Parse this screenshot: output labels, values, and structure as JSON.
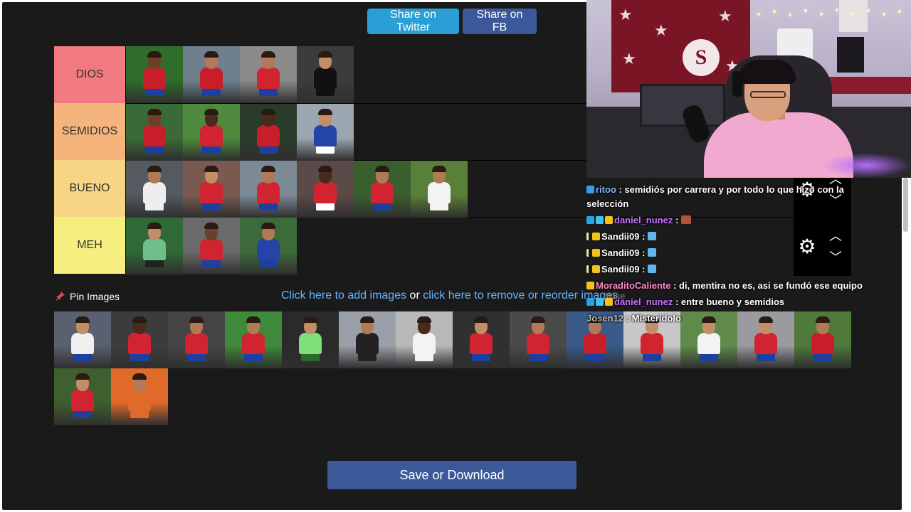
{
  "header": {
    "share_twitter": "Share on Twitter",
    "share_fb": "Share on FB"
  },
  "tiers": [
    {
      "label": "DIOS",
      "color": "#f07a7f",
      "players": [
        {
          "bg": "#2e6d2a",
          "shirt": "#c81e2a",
          "skin": "#6b3f2a",
          "shorts": "#1f3fa0"
        },
        {
          "bg": "#6f7f8c",
          "shirt": "#c81e2a",
          "skin": "#b07a56",
          "shorts": "#1f3fa0"
        },
        {
          "bg": "#8a8a8a",
          "shirt": "#d22430",
          "skin": "#b07a56",
          "shorts": "#1f3fa0"
        },
        {
          "bg": "#3c3c3c",
          "shirt": "#111111",
          "skin": "#c38d68",
          "shorts": "#111111"
        }
      ]
    },
    {
      "label": "SEMIDIOS",
      "color": "#f5b47c",
      "players": [
        {
          "bg": "#3a6a35",
          "shirt": "#c81e2a",
          "skin": "#6b3f2a",
          "shorts": "#1f3fa0"
        },
        {
          "bg": "#4f8a3e",
          "shirt": "#d22430",
          "skin": "#4a2a1c",
          "shorts": "#1f3fa0"
        },
        {
          "bg": "#2b3b2a",
          "shirt": "#c81e2a",
          "skin": "#4a2a1c",
          "shorts": "#1f3fa0"
        },
        {
          "bg": "#9aa6b0",
          "shirt": "#2444a8",
          "skin": "#c38d68",
          "shorts": "#ffffff"
        }
      ]
    },
    {
      "label": "BUENO",
      "color": "#f6d584",
      "players": [
        {
          "bg": "#555a60",
          "shirt": "#eeeeee",
          "skin": "#b07a56",
          "shorts": "#eeeeee"
        },
        {
          "bg": "#7a5a50",
          "shirt": "#d22430",
          "skin": "#c38d68",
          "shorts": "#1f3fa0"
        },
        {
          "bg": "#7c8a96",
          "shirt": "#d22430",
          "skin": "#b07a56",
          "shorts": "#1f3fa0"
        },
        {
          "bg": "#5c4a48",
          "shirt": "#d22430",
          "skin": "#4a2a1c",
          "shorts": "#ffffff"
        },
        {
          "bg": "#3a5f2f",
          "shirt": "#d22430",
          "skin": "#b07a56",
          "shorts": "#1f3fa0"
        },
        {
          "bg": "#5a7f38",
          "shirt": "#f3f3f3",
          "skin": "#b07a56",
          "shorts": "#f3f3f3"
        }
      ]
    },
    {
      "label": "MEH",
      "color": "#f7ee80",
      "players": [
        {
          "bg": "#2f6a36",
          "shirt": "#6fbf8a",
          "skin": "#c38d68",
          "shorts": "#222222"
        },
        {
          "bg": "#6a6a6a",
          "shirt": "#d22430",
          "skin": "#6b3f2a",
          "shorts": "#1f3fa0"
        },
        {
          "bg": "#3d6a3a",
          "shirt": "#2444a8",
          "skin": "#b07a56",
          "shorts": "#1f3fa0"
        }
      ]
    }
  ],
  "pin": {
    "label": "Pin Images",
    "add_link": "Click here to add images",
    "or_text": " or ",
    "reorder_link": "click here to remove or reorder images",
    "close": "close"
  },
  "pool": [
    {
      "bg": "#5a6070",
      "shirt": "#f0f0f0",
      "skin": "#c38d68",
      "shorts": "#1f3fa0"
    },
    {
      "bg": "#3c3c3c",
      "shirt": "#d22430",
      "skin": "#4a2a1c",
      "shorts": "#1f3fa0"
    },
    {
      "bg": "#444444",
      "shirt": "#d22430",
      "skin": "#b07a56",
      "shorts": "#1f3fa0"
    },
    {
      "bg": "#3f8a3a",
      "shirt": "#d22430",
      "skin": "#b07a56",
      "shorts": "#1f3fa0"
    },
    {
      "bg": "#2a2a2a",
      "shirt": "#7fe07a",
      "skin": "#c38d68",
      "shorts": "#2a6a2a"
    },
    {
      "bg": "#9aa0a8",
      "shirt": "#222222",
      "skin": "#b07a56",
      "shorts": "#222222"
    },
    {
      "bg": "#b8b8b8",
      "shirt": "#f3f3f3",
      "skin": "#4a2a1c",
      "shorts": "#f3f3f3"
    },
    {
      "bg": "#303030",
      "shirt": "#d22430",
      "skin": "#c38d68",
      "shorts": "#1f3fa0"
    },
    {
      "bg": "#4a4a4a",
      "shirt": "#d22430",
      "skin": "#b07a56",
      "shorts": "#1f3fa0"
    },
    {
      "bg": "#3a5a8a",
      "shirt": "#c81e2a",
      "skin": "#b07a56",
      "shorts": "#1f3fa0"
    },
    {
      "bg": "#c8c8c8",
      "shirt": "#d22430",
      "skin": "#c38d68",
      "shorts": "#1f3fa0"
    },
    {
      "bg": "#5f8a4a",
      "shirt": "#f3f3f3",
      "skin": "#c38d68",
      "shorts": "#1f3fa0"
    },
    {
      "bg": "#9a9aa0",
      "shirt": "#d22430",
      "skin": "#c38d68",
      "shorts": "#1f3fa0"
    },
    {
      "bg": "#4f7a3a",
      "shirt": "#c81e2a",
      "skin": "#b07a56",
      "shorts": "#1f3fa0"
    },
    {
      "bg": "#3f5f2f",
      "shirt": "#d22430",
      "skin": "#c38d68",
      "shorts": "#1f3fa0"
    },
    {
      "bg": "#e06a2a",
      "shirt": "#e06a2a",
      "skin": "#b07a56",
      "shorts": "#e06a2a"
    }
  ],
  "footer": {
    "save": "Save or Download"
  },
  "chat": {
    "messages": [
      {
        "user": "ritoo",
        "sep": " : ",
        "text": "semidiós por carrera y por todo lo que hizo con la",
        "cls": "u-ritoo",
        "badges": [
          "b-blue"
        ]
      },
      {
        "user": "",
        "sep": "",
        "text": "selección",
        "cls": "u-ritoo",
        "badges": []
      },
      {
        "user": "daniel_nunez",
        "sep": " : ",
        "text": "",
        "cls": "u-daniel",
        "badges": [
          "b-blue",
          "b-cyan",
          "b-gold"
        ],
        "emote": "emote"
      },
      {
        "user": "Sandii09",
        "sep": " : ",
        "text": "",
        "cls": "u-sandi",
        "badges": [
          "b-drop",
          "b-gold"
        ],
        "emote": "emote fly"
      },
      {
        "user": "Sandii09",
        "sep": " : ",
        "text": "",
        "cls": "u-sandi",
        "badges": [
          "b-drop",
          "b-gold"
        ],
        "emote": "emote fly"
      },
      {
        "user": "Sandii09",
        "sep": " : ",
        "text": "",
        "cls": "u-sandi",
        "badges": [
          "b-drop",
          "b-gold"
        ],
        "emote": "emote fly"
      },
      {
        "user": "MoraditoCaliente",
        "sep": " : ",
        "text": "di, mentira no es, asi se fundó ese equipo",
        "cls": "u-moradito",
        "badges": [
          "b-gold"
        ]
      },
      {
        "user": "daniel_nunez",
        "sep": " : ",
        "text": "entre bueno y semidios",
        "cls": "u-daniel",
        "badges": [
          "b-blue",
          "b-cyan",
          "b-gold"
        ]
      },
      {
        "user": "Josen12",
        "sep": " : ",
        "text": "Misteridolo",
        "cls": "u-josen",
        "badges": []
      }
    ]
  }
}
